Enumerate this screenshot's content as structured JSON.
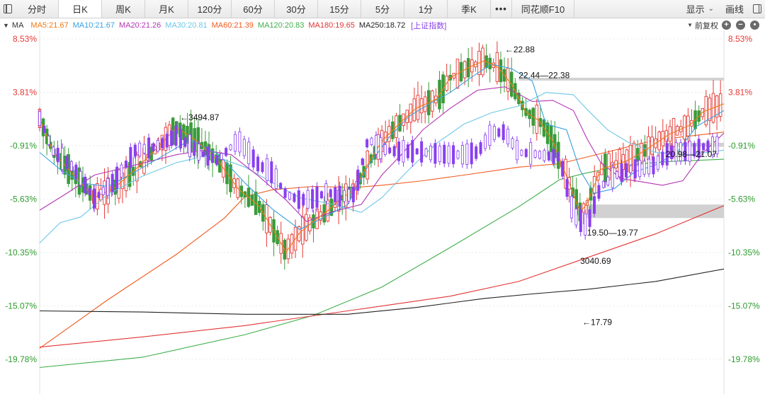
{
  "toolbar": {
    "tabs": [
      "分时",
      "日K",
      "周K",
      "月K",
      "120分",
      "60分",
      "30分",
      "15分",
      "5分",
      "1分",
      "季K",
      "•••",
      "同花顺F10"
    ],
    "active_tab": "日K",
    "display_label": "显示",
    "draw_label": "画线"
  },
  "ma_legend": {
    "title": "MA",
    "items": [
      {
        "label": "MA5:21.67",
        "color": "#f07a12"
      },
      {
        "label": "MA10:21.67",
        "color": "#3aa0e0"
      },
      {
        "label": "MA20:21.26",
        "color": "#b436b4"
      },
      {
        "label": "MA30:20.81",
        "color": "#6dc7e6"
      },
      {
        "label": "MA60:21.39",
        "color": "#f05a1e"
      },
      {
        "label": "MA120:20.83",
        "color": "#3fae4a"
      },
      {
        "label": "MA180:19.65",
        "color": "#e23535"
      },
      {
        "label": "MA250:18.72",
        "color": "#222222"
      }
    ],
    "index_label": "[上证指数]",
    "adjust_label": "前复权",
    "zoom_in": "+",
    "zoom_out": "−",
    "settings": "•"
  },
  "chart_data": {
    "type": "candlestick",
    "y_labels_pct": [
      "8.53%",
      "3.81%",
      "-0.91%",
      "-5.63%",
      "-10.35%",
      "-15.07%",
      "-19.78%"
    ],
    "y_values_pct": [
      8.53,
      3.81,
      -0.91,
      -5.63,
      -10.35,
      -15.07,
      -19.78
    ],
    "ylim_pct": [
      -19.78,
      8.53
    ],
    "colors": {
      "up": "#e53935",
      "down": "#3a9b3a",
      "index": "#8a3ff0",
      "zone": "#c9c9c9"
    },
    "annotations": [
      {
        "text": "←22.88",
        "x": 0.68,
        "pct": 7.6
      },
      {
        "text": "22.44—22.38",
        "x": 0.7,
        "pct": 5.3
      },
      {
        "text": "←3494.87",
        "x": 0.205,
        "pct": 1.6
      },
      {
        "text": "20.98—21.07",
        "x": 0.915,
        "pct": -1.65
      },
      {
        "text": "19.50—19.77",
        "x": 0.8,
        "pct": -8.6
      },
      {
        "text": "3040.69",
        "x": 0.79,
        "pct": -11.1
      },
      {
        "text": "←17.79",
        "x": 0.793,
        "pct": -16.5
      }
    ],
    "zones": [
      {
        "label": "22.44—22.38",
        "x0": 0.7,
        "x1": 1.0,
        "pct_top": 5.1,
        "pct_bot": 4.85
      },
      {
        "label": "20.98—21.07",
        "x0": 0.91,
        "x1": 1.0,
        "pct_top": -0.65,
        "pct_bot": -1.0
      },
      {
        "label": "19.50—19.77",
        "x0": 0.8,
        "x1": 1.0,
        "pct_top": -6.1,
        "pct_bot": -7.3
      }
    ],
    "ma_series": [
      {
        "name": "MA60",
        "color": "#f05a1e",
        "pts": [
          [
            0.0,
            -18.8
          ],
          [
            0.1,
            -14.5
          ],
          [
            0.2,
            -10.5
          ],
          [
            0.27,
            -7.3
          ],
          [
            0.3,
            -5.4
          ],
          [
            0.34,
            -4.8
          ],
          [
            0.4,
            -4.5
          ],
          [
            0.46,
            -4.6
          ],
          [
            0.5,
            -4.4
          ],
          [
            0.56,
            -4.0
          ],
          [
            0.62,
            -3.5
          ],
          [
            0.7,
            -2.8
          ],
          [
            0.76,
            -2.5
          ],
          [
            0.82,
            -1.6
          ],
          [
            0.9,
            -0.4
          ],
          [
            1.0,
            0.3
          ]
        ]
      },
      {
        "name": "MA120",
        "color": "#3fae4a",
        "pts": [
          [
            0.0,
            -20.5
          ],
          [
            0.15,
            -19.6
          ],
          [
            0.3,
            -17.6
          ],
          [
            0.4,
            -15.9
          ],
          [
            0.5,
            -13.4
          ],
          [
            0.6,
            -9.9
          ],
          [
            0.7,
            -6.3
          ],
          [
            0.76,
            -3.9
          ],
          [
            0.8,
            -3.3
          ],
          [
            0.86,
            -2.6
          ],
          [
            0.92,
            -2.3
          ],
          [
            1.0,
            -2.1
          ]
        ]
      },
      {
        "name": "MA180",
        "color": "#e23535",
        "pts": [
          [
            0.0,
            -18.7
          ],
          [
            0.15,
            -17.8
          ],
          [
            0.3,
            -16.8
          ],
          [
            0.45,
            -15.5
          ],
          [
            0.6,
            -14.2
          ],
          [
            0.7,
            -12.9
          ],
          [
            0.8,
            -10.8
          ],
          [
            0.9,
            -8.7
          ],
          [
            1.0,
            -6.2
          ]
        ]
      },
      {
        "name": "MA250",
        "color": "#222222",
        "pts": [
          [
            0.0,
            -15.5
          ],
          [
            0.15,
            -15.6
          ],
          [
            0.3,
            -15.8
          ],
          [
            0.45,
            -15.8
          ],
          [
            0.55,
            -15.2
          ],
          [
            0.65,
            -14.4
          ],
          [
            0.72,
            -14.0
          ],
          [
            0.8,
            -13.6
          ],
          [
            0.9,
            -12.9
          ],
          [
            1.0,
            -11.8
          ]
        ]
      },
      {
        "name": "MA30",
        "color": "#6dc7e6",
        "pts": [
          [
            0.0,
            -9.5
          ],
          [
            0.03,
            -7.7
          ],
          [
            0.06,
            -7.2
          ],
          [
            0.1,
            -5.2
          ],
          [
            0.15,
            -3.6
          ],
          [
            0.2,
            -2.4
          ],
          [
            0.25,
            -1.7
          ],
          [
            0.3,
            -2.8
          ],
          [
            0.35,
            -4.5
          ],
          [
            0.38,
            -5.5
          ],
          [
            0.43,
            -6.1
          ],
          [
            0.47,
            -6.8
          ],
          [
            0.5,
            -5.5
          ],
          [
            0.54,
            -3.0
          ],
          [
            0.58,
            -0.7
          ],
          [
            0.62,
            1.0
          ],
          [
            0.66,
            2.0
          ],
          [
            0.7,
            2.6
          ],
          [
            0.74,
            3.8
          ],
          [
            0.78,
            3.6
          ],
          [
            0.8,
            2.3
          ],
          [
            0.83,
            0.5
          ],
          [
            0.86,
            -0.6
          ],
          [
            0.9,
            -1.5
          ],
          [
            0.95,
            -1.7
          ],
          [
            1.0,
            -1.3
          ]
        ]
      },
      {
        "name": "MA20",
        "color": "#b436b4",
        "pts": [
          [
            0.0,
            -6.6
          ],
          [
            0.04,
            -5.1
          ],
          [
            0.08,
            -3.5
          ],
          [
            0.12,
            -2.9
          ],
          [
            0.16,
            -2.3
          ],
          [
            0.2,
            -1.7
          ],
          [
            0.24,
            -1.3
          ],
          [
            0.28,
            -1.7
          ],
          [
            0.32,
            -3.6
          ],
          [
            0.36,
            -5.7
          ],
          [
            0.39,
            -7.6
          ],
          [
            0.43,
            -6.7
          ],
          [
            0.47,
            -6.1
          ],
          [
            0.5,
            -3.5
          ],
          [
            0.53,
            -1.6
          ],
          [
            0.56,
            0.5
          ],
          [
            0.6,
            2.4
          ],
          [
            0.64,
            4.0
          ],
          [
            0.68,
            4.3
          ],
          [
            0.72,
            3.0
          ],
          [
            0.75,
            3.1
          ],
          [
            0.78,
            2.2
          ],
          [
            0.8,
            -0.3
          ],
          [
            0.82,
            -2.4
          ],
          [
            0.85,
            -3.8
          ],
          [
            0.88,
            -4.1
          ],
          [
            0.91,
            -4.4
          ],
          [
            0.94,
            -4.0
          ],
          [
            0.97,
            -1.5
          ],
          [
            1.0,
            0.2
          ]
        ]
      },
      {
        "name": "MA10",
        "color": "#3aa0e0",
        "pts": [
          [
            0.0,
            -1.5
          ],
          [
            0.03,
            -3.0
          ],
          [
            0.06,
            -4.2
          ],
          [
            0.1,
            -4.5
          ],
          [
            0.14,
            -3.2
          ],
          [
            0.18,
            -1.8
          ],
          [
            0.22,
            -0.4
          ],
          [
            0.26,
            -1.6
          ],
          [
            0.3,
            -4.2
          ],
          [
            0.34,
            -6.5
          ],
          [
            0.38,
            -8.3
          ],
          [
            0.42,
            -7.1
          ],
          [
            0.45,
            -6.1
          ],
          [
            0.48,
            -2.7
          ],
          [
            0.51,
            -0.2
          ],
          [
            0.54,
            1.7
          ],
          [
            0.57,
            2.8
          ],
          [
            0.6,
            3.8
          ],
          [
            0.63,
            5.1
          ],
          [
            0.66,
            6.3
          ],
          [
            0.69,
            5.9
          ],
          [
            0.72,
            4.8
          ],
          [
            0.74,
            1.0
          ],
          [
            0.77,
            0.5
          ],
          [
            0.79,
            -3.1
          ],
          [
            0.81,
            -5.1
          ],
          [
            0.84,
            -4.7
          ],
          [
            0.87,
            -3.2
          ],
          [
            0.9,
            -2.6
          ],
          [
            0.93,
            -1.6
          ],
          [
            0.96,
            0.8
          ],
          [
            1.0,
            2.2
          ]
        ]
      },
      {
        "name": "MA5",
        "color": "#f07a12",
        "pts": [
          [
            0.0,
            1.5
          ],
          [
            0.02,
            -1.5
          ],
          [
            0.05,
            -3.5
          ],
          [
            0.08,
            -5.5
          ],
          [
            0.11,
            -4.6
          ],
          [
            0.14,
            -3.0
          ],
          [
            0.17,
            -1.2
          ],
          [
            0.2,
            0.7
          ],
          [
            0.23,
            -0.5
          ],
          [
            0.26,
            -2.2
          ],
          [
            0.29,
            -4.7
          ],
          [
            0.32,
            -6.2
          ],
          [
            0.34,
            -8.2
          ],
          [
            0.36,
            -10.3
          ],
          [
            0.38,
            -8.6
          ],
          [
            0.4,
            -7.6
          ],
          [
            0.42,
            -6.7
          ],
          [
            0.44,
            -5.6
          ],
          [
            0.46,
            -4.8
          ],
          [
            0.48,
            -2.5
          ],
          [
            0.5,
            -0.5
          ],
          [
            0.53,
            1.3
          ],
          [
            0.55,
            2.4
          ],
          [
            0.58,
            3.2
          ],
          [
            0.6,
            5.1
          ],
          [
            0.63,
            6.1
          ],
          [
            0.65,
            6.6
          ],
          [
            0.67,
            6.0
          ],
          [
            0.69,
            4.5
          ],
          [
            0.71,
            2.1
          ],
          [
            0.73,
            1.3
          ],
          [
            0.75,
            -0.5
          ],
          [
            0.77,
            -3.6
          ],
          [
            0.79,
            -6.8
          ],
          [
            0.8,
            -6.0
          ],
          [
            0.82,
            -3.0
          ],
          [
            0.84,
            -2.6
          ],
          [
            0.86,
            -2.2
          ],
          [
            0.88,
            -1.5
          ],
          [
            0.9,
            -0.7
          ],
          [
            0.92,
            0.1
          ],
          [
            0.95,
            0.9
          ],
          [
            0.97,
            2.1
          ],
          [
            1.0,
            2.8
          ]
        ]
      }
    ],
    "index_line": [
      [
        0.0,
        1.5
      ],
      [
        0.02,
        -1.4
      ],
      [
        0.05,
        -2.9
      ],
      [
        0.08,
        -5.6
      ],
      [
        0.11,
        -4.0
      ],
      [
        0.14,
        -1.3
      ],
      [
        0.17,
        -1.0
      ],
      [
        0.2,
        0.0
      ],
      [
        0.23,
        -1.4
      ],
      [
        0.26,
        -2.2
      ],
      [
        0.29,
        -0.4
      ],
      [
        0.32,
        -2.6
      ],
      [
        0.34,
        -3.3
      ],
      [
        0.36,
        -5.2
      ],
      [
        0.38,
        -5.7
      ],
      [
        0.4,
        -5.6
      ],
      [
        0.42,
        -5.0
      ],
      [
        0.44,
        -5.4
      ],
      [
        0.46,
        -5.2
      ],
      [
        0.48,
        -0.3
      ],
      [
        0.5,
        -1.2
      ],
      [
        0.52,
        -1.4
      ],
      [
        0.55,
        -1.4
      ],
      [
        0.58,
        -1.6
      ],
      [
        0.6,
        -1.7
      ],
      [
        0.62,
        -1.7
      ],
      [
        0.64,
        -1.5
      ],
      [
        0.66,
        0.2
      ],
      [
        0.68,
        0.3
      ],
      [
        0.7,
        -1.5
      ],
      [
        0.72,
        -1.6
      ],
      [
        0.74,
        -1.8
      ],
      [
        0.76,
        -1.9
      ],
      [
        0.78,
        -7.0
      ],
      [
        0.8,
        -8.0
      ],
      [
        0.82,
        -4.5
      ],
      [
        0.84,
        -3.6
      ],
      [
        0.86,
        -3.0
      ],
      [
        0.88,
        -2.9
      ],
      [
        0.9,
        -2.6
      ],
      [
        0.92,
        -1.5
      ],
      [
        0.95,
        -1.4
      ],
      [
        0.97,
        -1.0
      ],
      [
        1.0,
        -0.8
      ]
    ]
  }
}
